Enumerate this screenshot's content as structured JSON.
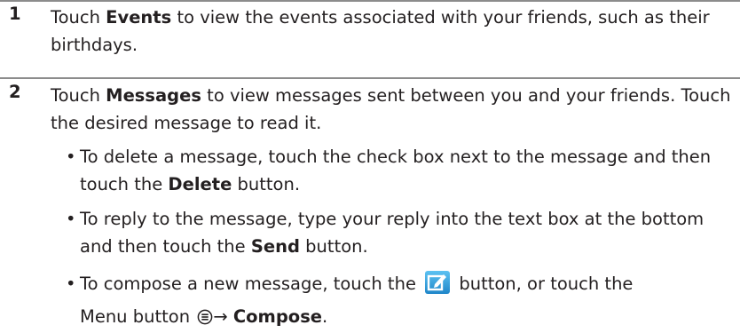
{
  "steps": [
    {
      "number": "1",
      "pre": "Touch ",
      "bold": "Events",
      "post": " to view the events associated with your friends, such as their birthdays."
    },
    {
      "number": "2",
      "pre": "Touch ",
      "bold": "Messages",
      "post": " to view messages sent between you and your friends. Touch the desired message to read it."
    }
  ],
  "bullets": {
    "b1": {
      "dot": "•",
      "pre": "To delete a message, touch the check box next to the message and then touch the ",
      "bold": "Delete",
      "post": " button."
    },
    "b2": {
      "dot": "•",
      "pre": "To reply to the message, type your reply into the text box at the bottom and then touch the ",
      "bold": "Send",
      "post": " button."
    },
    "b3": {
      "dot": "•",
      "pre": "To compose a new message, touch the",
      "mid": "button, or touch the",
      "line2_pre": "Menu button ",
      "arrow": "→ ",
      "bold": "Compose",
      "post": "."
    }
  },
  "icons": {
    "compose": "compose-message-icon",
    "menu": "menu-button-icon",
    "accent": "#2b9ad6"
  }
}
